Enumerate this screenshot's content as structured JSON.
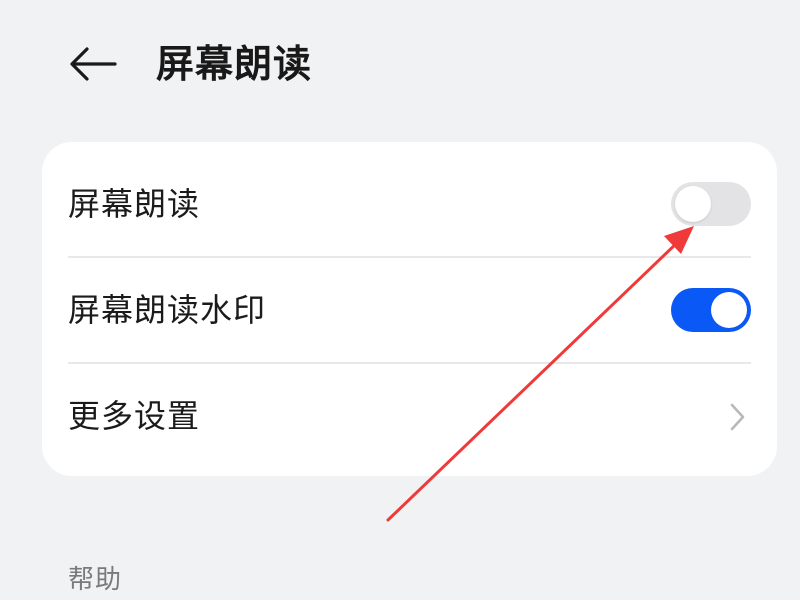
{
  "header": {
    "title": "屏幕朗读"
  },
  "settings": [
    {
      "label": "屏幕朗读",
      "control": "toggle",
      "state": "off"
    },
    {
      "label": "屏幕朗读水印",
      "control": "toggle",
      "state": "on"
    },
    {
      "label": "更多设置",
      "control": "chevron"
    }
  ],
  "section": {
    "title": "帮助"
  },
  "icons": {
    "back": "back-arrow-icon",
    "chevron": "chevron-right-icon"
  },
  "colors": {
    "background": "#f1f2f4",
    "card": "#ffffff",
    "toggle_on": "#0a59f7",
    "toggle_off": "#e3e3e5",
    "annotation": "#f03a3a"
  }
}
